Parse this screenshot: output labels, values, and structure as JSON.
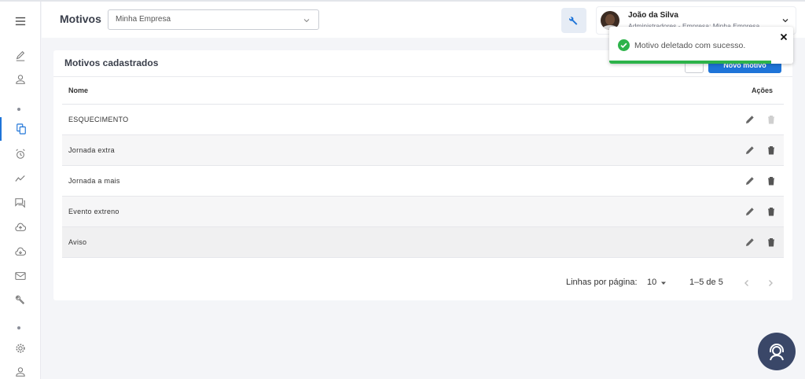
{
  "header": {
    "title": "Motivos",
    "company_select": "Minha Empresa",
    "user_name": "João da Silva",
    "user_role": "Administradores - Empresa: Minha Empresa"
  },
  "card": {
    "title": "Motivos cadastrados",
    "new_button": "Novo motivo",
    "columns": {
      "name": "Nome",
      "actions": "Ações"
    },
    "rows": [
      {
        "name": "ESQUECIMENTO",
        "delete_enabled": false
      },
      {
        "name": "Jornada extra",
        "delete_enabled": true
      },
      {
        "name": "Jornada a mais",
        "delete_enabled": true
      },
      {
        "name": "Evento extreno",
        "delete_enabled": true
      },
      {
        "name": "Aviso",
        "delete_enabled": true
      }
    ],
    "pagination": {
      "rows_per_page_label": "Linhas por página:",
      "rows_per_page": "10",
      "range": "1–5 de 5"
    }
  },
  "toast": {
    "message": "Motivo deletado com sucesso.",
    "progress": 0.88
  },
  "colors": {
    "accent": "#1e74d8",
    "success": "#2db34a",
    "help_button": "#3a4768"
  },
  "sidebar_icons": [
    "pencil-icon",
    "person-icon",
    "dot",
    "documents-icon",
    "alarm-icon",
    "trend-icon",
    "chat-icon",
    "cloud-upload-icon",
    "cloud-download-icon",
    "mail-icon",
    "wrench-icon",
    "dot",
    "gear-icon",
    "person-icon"
  ]
}
